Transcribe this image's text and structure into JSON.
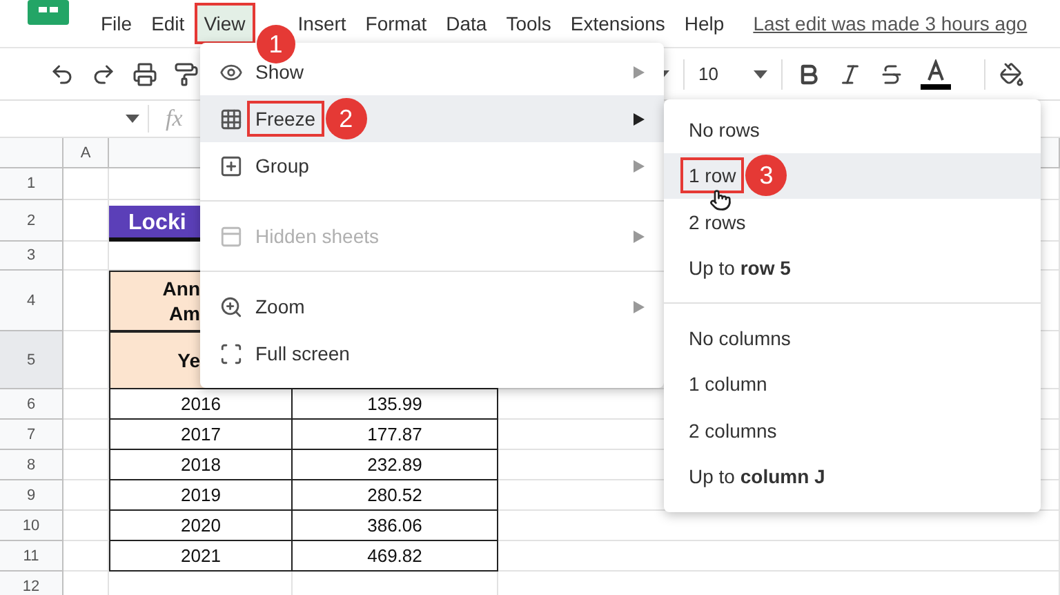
{
  "menubar": {
    "items": [
      {
        "label": "File",
        "selected": false
      },
      {
        "label": "Edit",
        "selected": false
      },
      {
        "label": "View",
        "selected": true,
        "callout": "1"
      },
      {
        "label": "Insert",
        "selected": false
      },
      {
        "label": "Format",
        "selected": false
      },
      {
        "label": "Data",
        "selected": false
      },
      {
        "label": "Tools",
        "selected": false
      },
      {
        "label": "Extensions",
        "selected": false
      },
      {
        "label": "Help",
        "selected": false
      }
    ],
    "last_edit": "Last edit was made 3 hours ago"
  },
  "toolbar": {
    "font_size": "10"
  },
  "formula_bar": {
    "fx": "fx"
  },
  "sheet": {
    "columns": [
      "A"
    ],
    "row_numbers": [
      "1",
      "2",
      "3",
      "4",
      "5",
      "6",
      "7",
      "8",
      "9",
      "10",
      "11",
      "12"
    ],
    "title": "Locki",
    "header_lines": [
      "Ann",
      "Am"
    ],
    "header_year": "Ye",
    "rows": [
      [
        "2016",
        "135.99"
      ],
      [
        "2017",
        "177.87"
      ],
      [
        "2018",
        "232.89"
      ],
      [
        "2019",
        "280.52"
      ],
      [
        "2020",
        "386.06"
      ],
      [
        "2021",
        "469.82"
      ]
    ]
  },
  "view_menu": {
    "items": [
      {
        "kind": "item",
        "label": "Show",
        "selected": false,
        "disabled": false,
        "submenu": true
      },
      {
        "kind": "item",
        "label": "Freeze",
        "selected": true,
        "disabled": false,
        "submenu": true,
        "callout": "2"
      },
      {
        "kind": "item",
        "label": "Group",
        "selected": false,
        "disabled": false,
        "submenu": true
      },
      {
        "kind": "divider"
      },
      {
        "kind": "item",
        "label": "Hidden sheets",
        "selected": false,
        "disabled": true,
        "submenu": true
      },
      {
        "kind": "divider"
      },
      {
        "kind": "item",
        "label": "Zoom",
        "selected": false,
        "disabled": false,
        "submenu": true
      },
      {
        "kind": "item",
        "label": "Full screen",
        "selected": false,
        "disabled": false,
        "submenu": false
      }
    ]
  },
  "freeze_menu": {
    "items": [
      {
        "kind": "item",
        "label": "No rows",
        "selected": false
      },
      {
        "kind": "item",
        "label": "1 row",
        "selected": true,
        "callout": "3"
      },
      {
        "kind": "item",
        "label": "2 rows",
        "selected": false
      },
      {
        "kind": "item",
        "label": "Up to **row 5**",
        "selected": false
      },
      {
        "kind": "divider"
      },
      {
        "kind": "item",
        "label": "No columns",
        "selected": false
      },
      {
        "kind": "item",
        "label": "1 column",
        "selected": false
      },
      {
        "kind": "item",
        "label": "2 columns",
        "selected": false
      },
      {
        "kind": "item",
        "label": "Up to **column J**",
        "selected": false
      }
    ]
  }
}
